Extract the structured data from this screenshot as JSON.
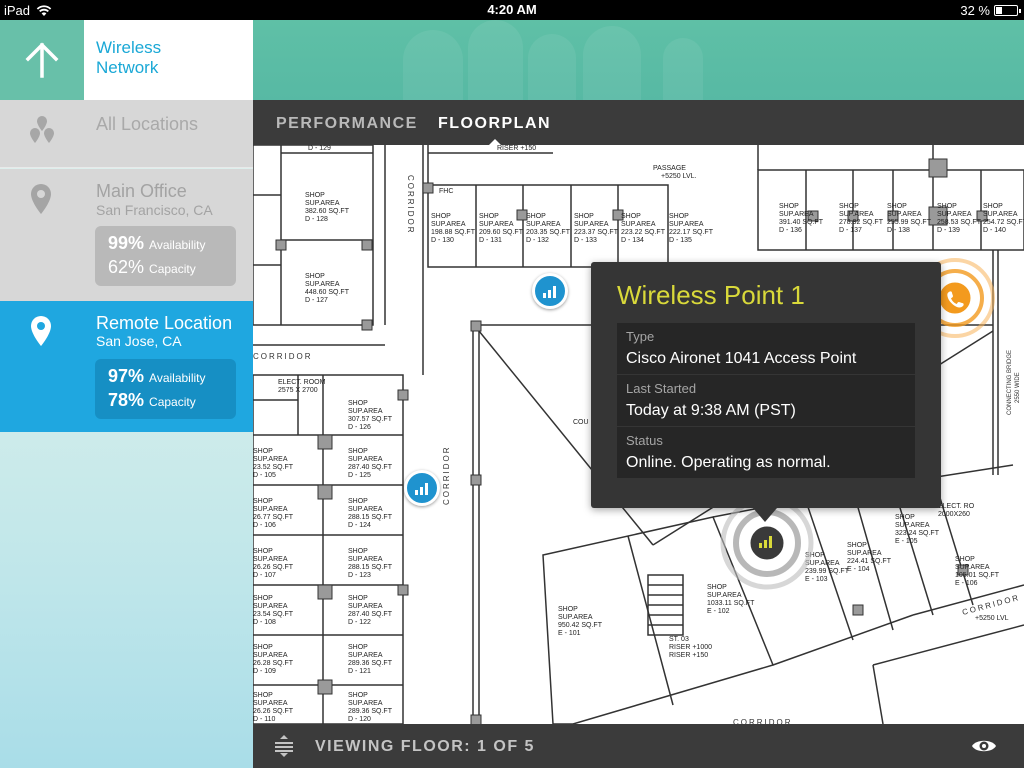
{
  "status_bar": {
    "device": "iPad",
    "time": "4:20 AM",
    "battery_text": "32 %",
    "battery_level": 0.32
  },
  "sidebar": {
    "back_icon": "arrow-up-icon",
    "title_line1": "Wireless",
    "title_line2": "Network",
    "locations": [
      {
        "name": "All Locations",
        "icon": "multi-pin-icon"
      },
      {
        "name": "Main Office",
        "sub": "San Francisco, CA",
        "availability": "99%",
        "availability_label": "Availability",
        "capacity": "62%",
        "capacity_label": "Capacity",
        "icon": "pin-icon"
      },
      {
        "name": "Remote Location",
        "sub": "San Jose, CA",
        "availability": "97%",
        "availability_label": "Availability",
        "capacity": "78%",
        "capacity_label": "Capacity",
        "icon": "pin-icon",
        "selected": true
      }
    ]
  },
  "tabs": {
    "performance": "PERFORMANCE",
    "floorplan": "FLOORPLAN",
    "active": "floorplan"
  },
  "floorplan": {
    "labels": {
      "corridor": "CORRIDOR",
      "passage": "PASSAGE",
      "passage_level": "+5250 LVL.",
      "riser": "RISER +150",
      "connecting_bridge": "CONNECTING BRIDGE",
      "bridge_width": "2550 WIDE",
      "elect_room": "ELECT. ROOM",
      "elect_room_size": "2575 X 2700",
      "elect_room_right": "ELECT. RO",
      "elect_room_right_size": "2000X260",
      "level_right": "+5250 LVL",
      "fhc": "FHC",
      "d_129": "D - 129",
      "shop": "SHOP",
      "sup_area": "SUP.AREA",
      "st": "ST. 03",
      "st_riser1": "RISER +1000",
      "st_riser2": "RISER +150",
      "room_partial": "COU"
    },
    "rooms": [
      {
        "sq": "198.88 SQ.FT",
        "id": "D - 130"
      },
      {
        "sq": "209.60 SQ.FT",
        "id": "D - 131"
      },
      {
        "sq": "203.35 SQ.FT",
        "id": "D - 132"
      },
      {
        "sq": "223.37 SQ.FT",
        "id": "D - 133"
      },
      {
        "sq": "223.22 SQ.FT",
        "id": "D - 134"
      },
      {
        "sq": "222.17 SQ.FT",
        "id": "D - 135"
      },
      {
        "sq": "382.60 SQ.FT",
        "id": "D - 128"
      },
      {
        "sq": "448.60 SQ.FT",
        "id": "D - 127"
      },
      {
        "sq": "391.40 SQ.FT",
        "id": "D - 136"
      },
      {
        "sq": "278.92 SQ.FT",
        "id": "D - 137"
      },
      {
        "sq": "255.99 SQ.FT",
        "id": "D - 138"
      },
      {
        "sq": "258.53 SQ.FT",
        "id": "D - 139"
      },
      {
        "sq": "254.72 SQ.FT",
        "id": "D - 140"
      },
      {
        "sq": "307.57 SQ.FT",
        "id": "D - 126"
      },
      {
        "sq": "287.40 SQ.FT",
        "id": "D - 125"
      },
      {
        "sq": "288.15 SQ.FT",
        "id": "D - 124"
      },
      {
        "sq": "288.15 SQ.FT",
        "id": "D - 123"
      },
      {
        "sq": "287.40 SQ.FT",
        "id": "D - 122"
      },
      {
        "sq": "289.36 SQ.FT",
        "id": "D - 121"
      },
      {
        "sq": "289.36 SQ.FT",
        "id": "D - 120"
      },
      {
        "sq": "23.52 SQ.FT",
        "id": "D - 105"
      },
      {
        "sq": "26.77 SQ.FT",
        "id": "D - 106"
      },
      {
        "sq": "26.26 SQ.FT",
        "id": "D - 107"
      },
      {
        "sq": "23.54 SQ.FT",
        "id": "D - 108"
      },
      {
        "sq": "26.28 SQ.FT",
        "id": "D - 109"
      },
      {
        "sq": "26.26 SQ.FT",
        "id": "D - 110"
      },
      {
        "sq": "950.42 SQ.FT",
        "id": "E - 101"
      },
      {
        "sq": "1033.11 SQ.FT",
        "id": "E - 102"
      },
      {
        "sq": "239.99 SQ.FT",
        "id": "E - 103"
      },
      {
        "sq": "224.41 SQ.FT",
        "id": "E - 104"
      },
      {
        "sq": "323.24 SQ.FT",
        "id": "E - 105"
      },
      {
        "sq": "105.01 SQ.FT",
        "id": "E - 106"
      }
    ]
  },
  "access_points": [
    {
      "icon": "signal-bars-icon"
    },
    {
      "icon": "signal-bars-icon"
    },
    {
      "icon": "signal-bars-icon",
      "active": true
    },
    {
      "icon": "phone-icon",
      "status_color": "#f39a1e"
    }
  ],
  "tooltip": {
    "title": "Wireless Point 1",
    "fields": [
      {
        "label": "Type",
        "value": "Cisco Aironet 1041 Access Point"
      },
      {
        "label": "Last Started",
        "value": "Today at 9:38 AM (PST)"
      },
      {
        "label": "Status",
        "value": "Online. Operating as normal."
      }
    ]
  },
  "bottom_bar": {
    "viewing_floor": "VIEWING FLOOR: 1 OF 5",
    "menu_icon": "layers-menu-icon",
    "eye_icon": "eye-icon"
  },
  "colors": {
    "accent_teal": "#5fc0a6",
    "accent_blue": "#1fa7e0",
    "ap_blue": "#1f93cf",
    "tooltip_title": "#d9d93a",
    "orange_alert": "#f39a1e",
    "dark_bar": "#3b3b3b"
  }
}
